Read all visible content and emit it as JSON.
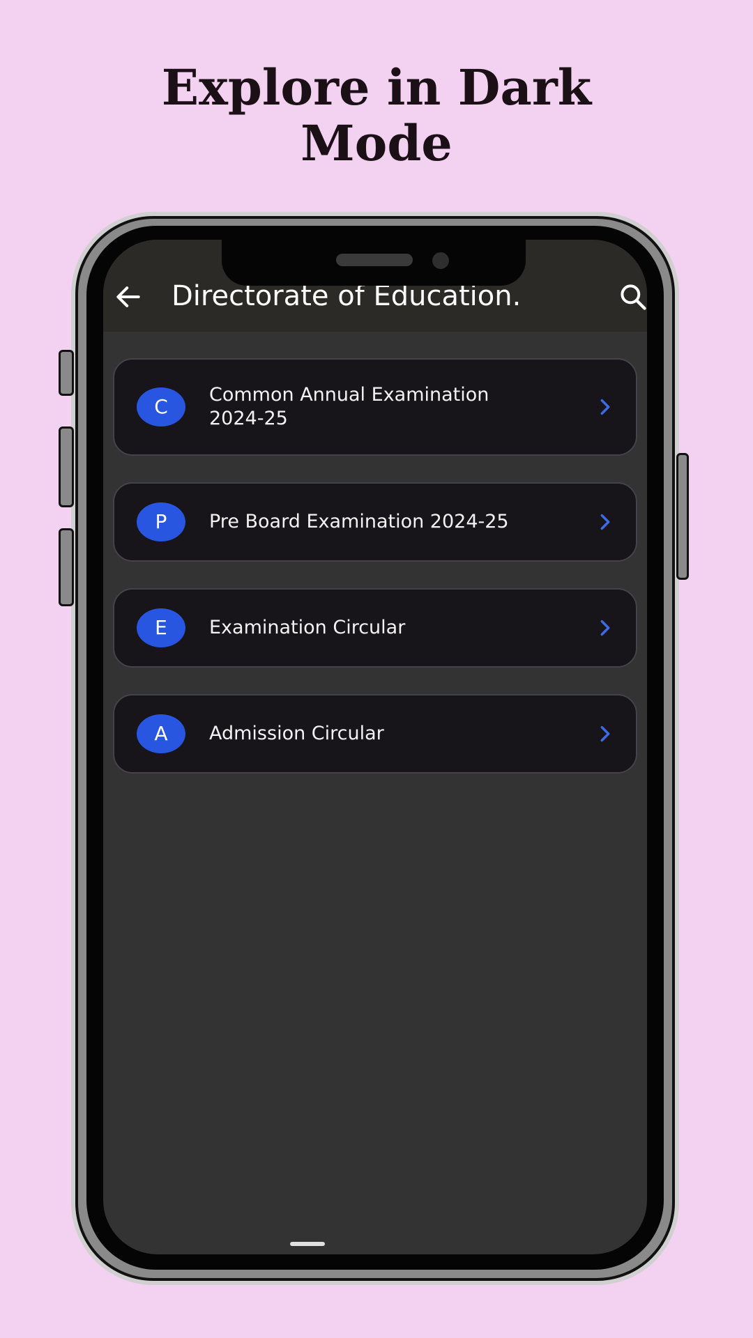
{
  "headline": {
    "line1": "Explore in Dark",
    "line2": "Mode"
  },
  "appbar": {
    "title": "Directorate of Education...",
    "back_icon": "back-arrow-icon",
    "search_icon": "search-icon"
  },
  "items": [
    {
      "letter": "C",
      "label": "Common Annual Examination 2024-25"
    },
    {
      "letter": "P",
      "label": "Pre Board Examination 2024-25"
    },
    {
      "letter": "E",
      "label": "Examination Circular"
    },
    {
      "letter": "A",
      "label": "Admission Circular"
    }
  ],
  "colors": {
    "background": "#f3d1f0",
    "screen": "#333333",
    "card": "#17151a",
    "accent": "#2856e0",
    "chevron": "#3d6be8"
  }
}
